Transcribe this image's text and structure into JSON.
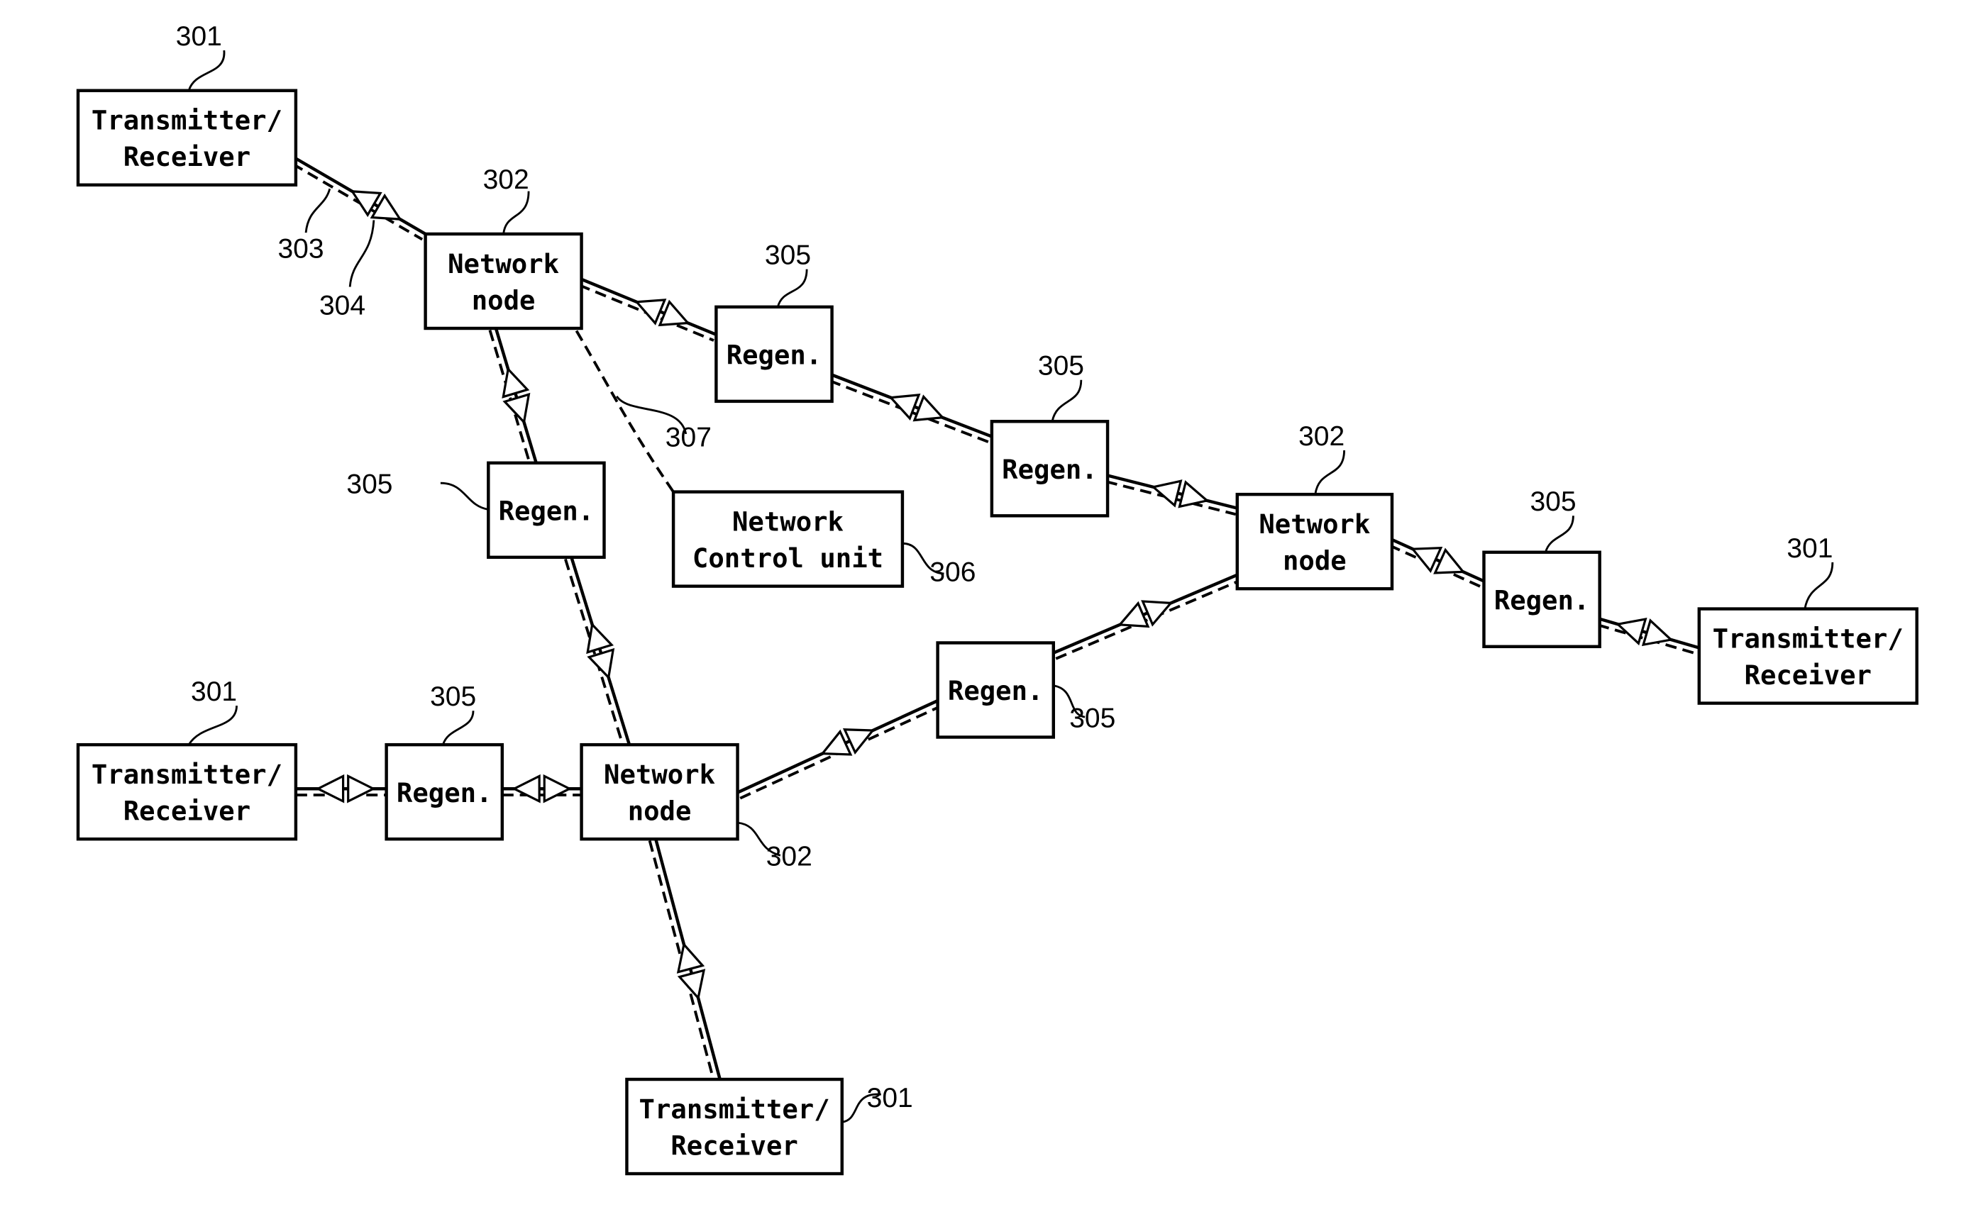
{
  "diagram": {
    "type": "optical network topology",
    "nodes": [
      {
        "id": "tr1",
        "kind": "transmitter-receiver",
        "lines": [
          "Transmitter/",
          "Receiver"
        ],
        "ref": "301"
      },
      {
        "id": "nn1",
        "kind": "network-node",
        "lines": [
          "Network",
          "node"
        ],
        "ref": "302"
      },
      {
        "id": "rg1",
        "kind": "regenerator",
        "lines": [
          "Regen."
        ],
        "ref": "305"
      },
      {
        "id": "rg2",
        "kind": "regenerator",
        "lines": [
          "Regen."
        ],
        "ref": "305"
      },
      {
        "id": "nn2",
        "kind": "network-node",
        "lines": [
          "Network",
          "node"
        ],
        "ref": "302"
      },
      {
        "id": "rg3",
        "kind": "regenerator",
        "lines": [
          "Regen."
        ],
        "ref": "305"
      },
      {
        "id": "tr2",
        "kind": "transmitter-receiver",
        "lines": [
          "Transmitter/",
          "Receiver"
        ],
        "ref": "301"
      },
      {
        "id": "rg4",
        "kind": "regenerator",
        "lines": [
          "Regen."
        ],
        "ref": "305"
      },
      {
        "id": "ncu",
        "kind": "network-control-unit",
        "lines": [
          "Network",
          "Control unit"
        ],
        "ref": "306"
      },
      {
        "id": "tr3",
        "kind": "transmitter-receiver",
        "lines": [
          "Transmitter/",
          "Receiver"
        ],
        "ref": "301"
      },
      {
        "id": "rg5",
        "kind": "regenerator",
        "lines": [
          "Regen."
        ],
        "ref": "305"
      },
      {
        "id": "nn3",
        "kind": "network-node",
        "lines": [
          "Network",
          "node"
        ],
        "ref": "302"
      },
      {
        "id": "rg6",
        "kind": "regenerator",
        "lines": [
          "Regen."
        ],
        "ref": "305"
      },
      {
        "id": "tr4",
        "kind": "transmitter-receiver",
        "lines": [
          "Transmitter/",
          "Receiver"
        ],
        "ref": "301"
      }
    ],
    "links": [
      {
        "from": "tr1",
        "to": "nn1"
      },
      {
        "from": "nn1",
        "to": "rg1"
      },
      {
        "from": "rg1",
        "to": "rg2"
      },
      {
        "from": "rg2",
        "to": "nn2"
      },
      {
        "from": "nn2",
        "to": "rg3"
      },
      {
        "from": "rg3",
        "to": "tr2"
      },
      {
        "from": "nn1",
        "to": "rg4"
      },
      {
        "from": "rg4",
        "to": "nn3"
      },
      {
        "from": "tr3",
        "to": "rg5"
      },
      {
        "from": "rg5",
        "to": "nn3"
      },
      {
        "from": "nn3",
        "to": "rg6"
      },
      {
        "from": "rg6",
        "to": "nn2"
      },
      {
        "from": "nn3",
        "to": "tr4"
      }
    ],
    "control_link": {
      "from": "nn1",
      "to": "ncu",
      "ref": "307"
    },
    "annotations": {
      "fiber_ref": "303",
      "amplifier_ref": "304"
    }
  }
}
